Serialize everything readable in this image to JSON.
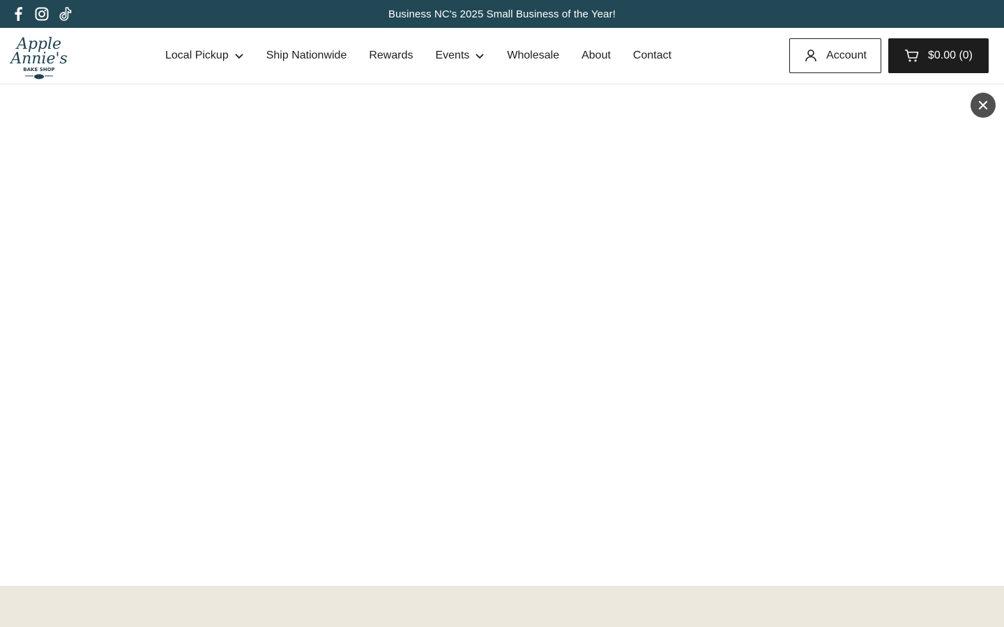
{
  "announcement": {
    "text": "Business NC's 2025 Small Business of the Year!"
  },
  "social": {
    "icons": [
      "facebook-icon",
      "instagram-icon",
      "tiktok-icon"
    ]
  },
  "logo": {
    "line1": "Apple",
    "line2": "Annie's",
    "line3": "BAKE SHOP"
  },
  "nav": {
    "items": [
      {
        "label": "Local Pickup",
        "has_dropdown": true
      },
      {
        "label": "Ship Nationwide",
        "has_dropdown": false
      },
      {
        "label": "Rewards",
        "has_dropdown": false
      },
      {
        "label": "Events",
        "has_dropdown": true
      },
      {
        "label": "Wholesale",
        "has_dropdown": false
      },
      {
        "label": "About",
        "has_dropdown": false
      },
      {
        "label": "Contact",
        "has_dropdown": false
      }
    ]
  },
  "header": {
    "account_label": "Account",
    "cart_label": "$0.00 (0)"
  },
  "colors": {
    "announcement_bg": "#224855",
    "cart_bg": "#1d1d1d",
    "close_bg": "#505050",
    "footer_band": "#ede8de"
  }
}
